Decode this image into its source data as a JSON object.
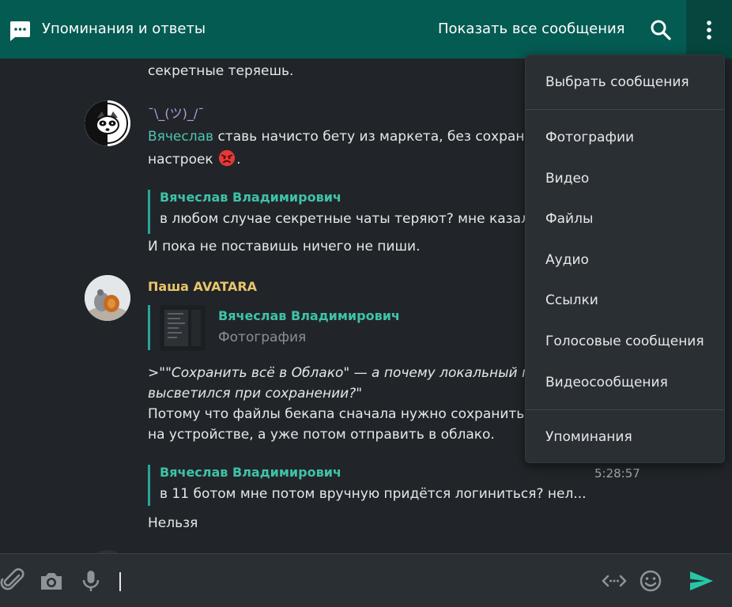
{
  "header": {
    "title": "Упоминания и ответы",
    "show_all": "Показать все сообщения",
    "icons": {
      "chat": "chat-icon",
      "search": "search-icon",
      "more": "more-vertical-icon"
    }
  },
  "messages": {
    "top_line": "секретные теряешь.",
    "m1": {
      "author": "¯\\_(ツ)_/¯",
      "author_color": "#b39ddb",
      "mention": "Вячеслав",
      "text_rest": " ставь начисто бету из маркета, без сохране",
      "line2": "настроек",
      "emoji": "angry-face",
      "reply_name": "Вячеслав Владимирович",
      "reply_text": "в любом случае секретные чаты теряют? мне казало",
      "text_after": "И пока не поставишь ничего не пиши."
    },
    "m2": {
      "author": "Паша AVATARA",
      "author_color": "#e9c46a",
      "reply_name": "Вячеслав Владимирович",
      "reply_sub": "Фотография",
      "quote_line1_prefix": ">",
      "quote_line1": "\"\"Сохранить всё в Облако\" — а почему локальный пут",
      "quote_line2": "высветился при сохранении?\"",
      "line3": "Потому что файлы бекапа сначала нужно сохранить г",
      "line4": "на устройстве, а уже потом отправить в облако."
    },
    "m3": {
      "reply_name": "Вячеслав Владимирович",
      "reply_text": "в 11 ботом мне потом вручную придётся логиниться? нел...",
      "time": "5:28:57",
      "text_after": "Нельзя"
    }
  },
  "composer": {
    "icons": [
      "attach-icon",
      "camera-icon",
      "microphone-icon",
      "code-icon",
      "emoji-icon",
      "send-icon"
    ],
    "send_color": "#26c6a6"
  },
  "menu": {
    "items": [
      "Выбрать сообщения",
      "Фотографии",
      "Видео",
      "Файлы",
      "Аудио",
      "Ссылки",
      "Голосовые сообщения",
      "Видеосообщения",
      "Упоминания"
    ]
  },
  "colors": {
    "header_bg": "#045b52",
    "chat_bg": "#212529",
    "accent": "#3fc2a8"
  }
}
